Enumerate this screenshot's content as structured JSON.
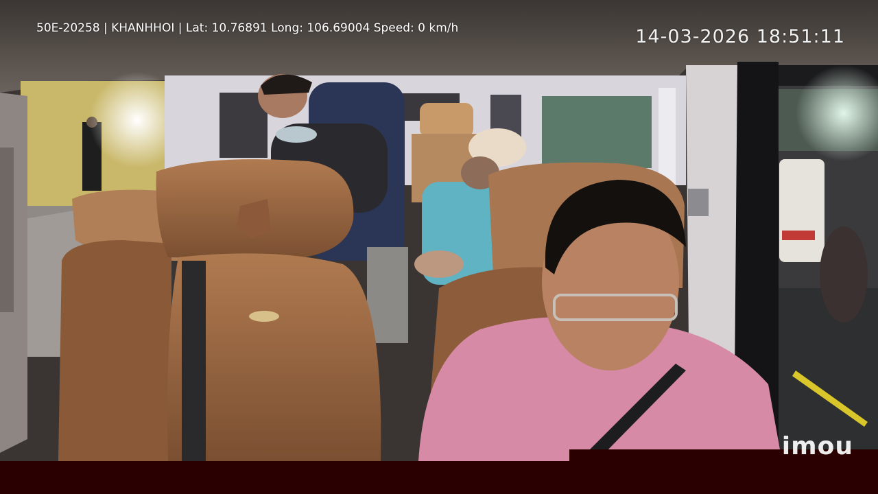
{
  "osd": {
    "info_line": "50E-20258 | KHANHHOI | Lat: 10.76891 Long: 106.69004 Speed: 0 km/h",
    "timestamp": "14-03-2026 18:51:11"
  },
  "watermark": {
    "logo_text": "imou"
  },
  "colors": {
    "bottom_bar": "#2b0000",
    "seat_leather": "#9a6a44",
    "driver_shirt": "#d98aa6"
  }
}
